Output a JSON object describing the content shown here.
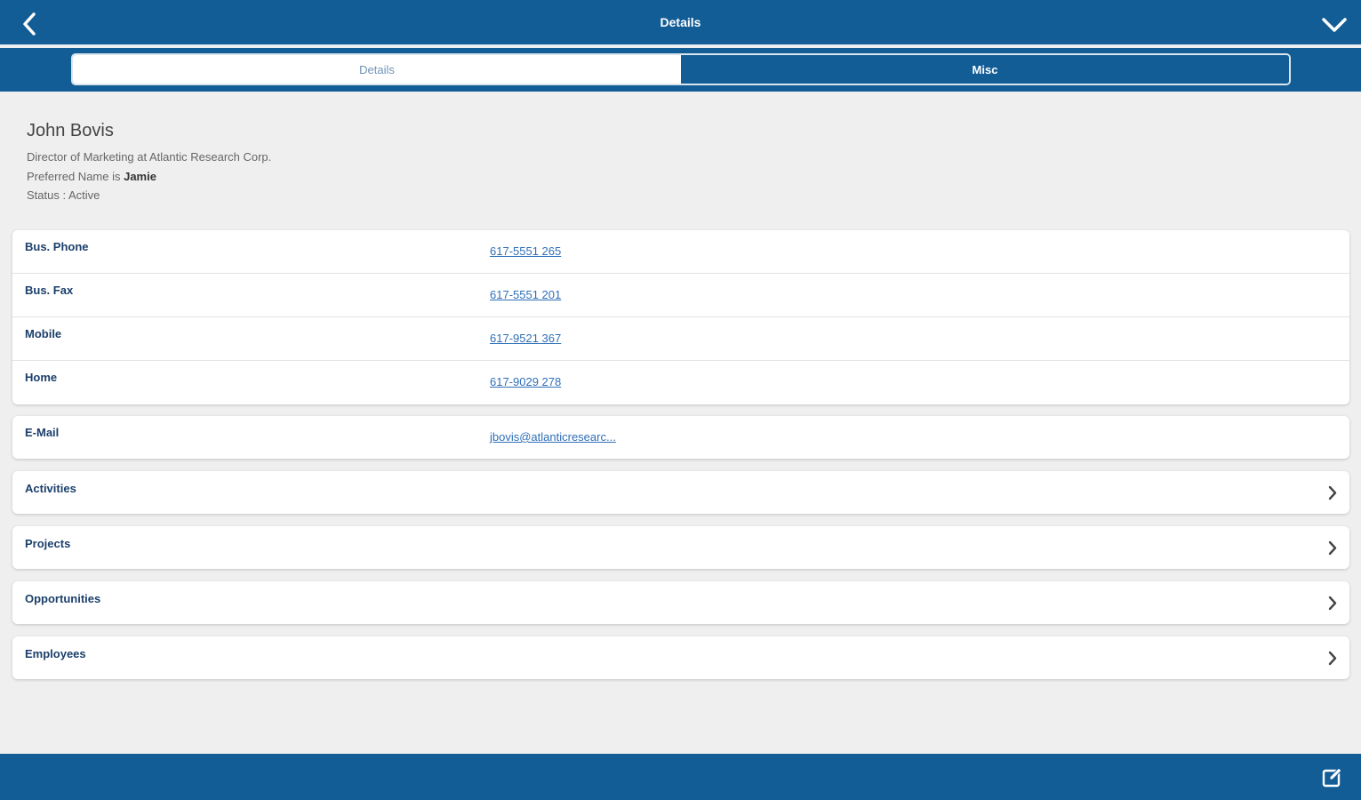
{
  "header": {
    "title": "Details",
    "back_icon": "chevron-left-icon",
    "menu_icon": "chevron-down-icon"
  },
  "tabs": [
    {
      "label": "Details",
      "active": true
    },
    {
      "label": "Misc",
      "active": false
    }
  ],
  "contact": {
    "name": "John Bovis",
    "title_line": "Director of Marketing at Atlantic Research Corp.",
    "preferred_prefix": "Preferred Name is ",
    "preferred_name": "Jamie",
    "status_line": "Status : Active"
  },
  "phones": [
    {
      "label": "Bus. Phone",
      "value": "617-5551 265"
    },
    {
      "label": "Bus. Fax",
      "value": "617-5551 201"
    },
    {
      "label": "Mobile",
      "value": "617-9521 367"
    },
    {
      "label": "Home",
      "value": "617-9029 278"
    }
  ],
  "email": {
    "label": "E-Mail",
    "value": "jbovis@atlanticresearc..."
  },
  "related": [
    {
      "label": "Activities"
    },
    {
      "label": "Projects"
    },
    {
      "label": "Opportunities"
    },
    {
      "label": "Employees"
    }
  ],
  "footer": {
    "edit_icon": "edit-icon"
  },
  "colors": {
    "brand": "#135d96",
    "label": "#1b3f6b",
    "link": "#2f6fb7",
    "background": "#efefef"
  }
}
